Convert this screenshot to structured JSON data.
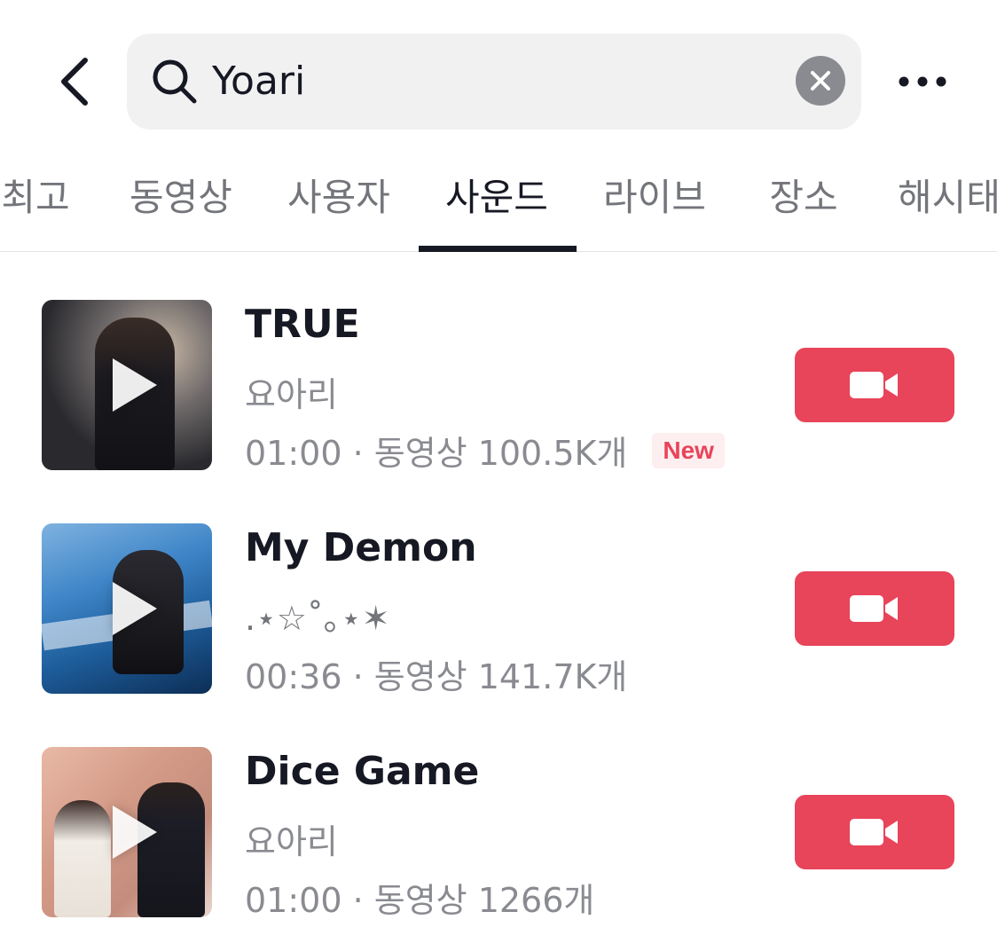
{
  "search": {
    "query": "Yoari"
  },
  "tabs": [
    {
      "label": "최고",
      "active": false
    },
    {
      "label": "동영상",
      "active": false
    },
    {
      "label": "사용자",
      "active": false
    },
    {
      "label": "사운드",
      "active": true
    },
    {
      "label": "라이브",
      "active": false
    },
    {
      "label": "장소",
      "active": false
    },
    {
      "label": "해시태그",
      "active": false
    }
  ],
  "sounds": [
    {
      "title": "TRUE",
      "artist": "요아리",
      "meta": "01:00 · 동영상 100.5K개",
      "badge": "New"
    },
    {
      "title": "My Demon",
      "artist": ".⋆☆˚｡⋆✶",
      "meta": "00:36 · 동영상 141.7K개",
      "badge": ""
    },
    {
      "title": "Dice Game",
      "artist": "요아리",
      "meta": "01:00 · 동영상 1266개",
      "badge": ""
    }
  ],
  "colors": {
    "accent": "#e8445a",
    "text": "#161823",
    "secondary_text": "#8a8b91",
    "search_bg": "#f1f1f2"
  },
  "icons": {
    "back": "chevron-left-icon",
    "search": "search-icon",
    "clear": "clear-icon",
    "more": "more-icon",
    "record": "video-camera-icon",
    "play": "play-icon"
  }
}
